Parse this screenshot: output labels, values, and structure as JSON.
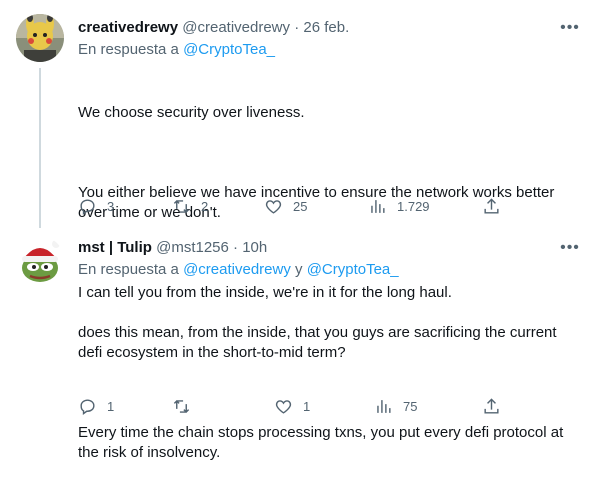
{
  "tweets": [
    {
      "name": "creativedrewy",
      "handle": "@creativedrewy",
      "dot": "·",
      "time": "26 feb.",
      "reply_prefix": "En respuesta a ",
      "reply_mention1": "@CryptoTea_",
      "reply_and": "",
      "reply_mention2": "",
      "paragraphs": [
        "We choose security over liveness.",
        "You either believe we have incentive to ensure the network works better over time or we don't.",
        "I can tell you from the inside, we're in it for the long haul."
      ],
      "replies": "3",
      "retweets": "2",
      "likes": "25",
      "views": "1.729",
      "more_icon": "ellipsis-icon"
    },
    {
      "name": "mst | Tulip",
      "handle": "@mst1256",
      "dot": "·",
      "time": "10h",
      "reply_prefix": "En respuesta a ",
      "reply_mention1": "@creativedrewy",
      "reply_and": " y ",
      "reply_mention2": "@CryptoTea_",
      "paragraphs": [
        "does this mean, from the inside, that you guys are sacrificing the current defi ecosystem in the short-to-mid term?",
        "Every time the chain stops processing txns, you put every defi protocol at the risk of insolvency."
      ],
      "replies": "1",
      "retweets": "",
      "likes": "1",
      "views": "75",
      "more_icon": "ellipsis-icon"
    }
  ],
  "colors": {
    "link": "#1d9bf0",
    "secondary_text": "#536471",
    "primary_text": "#0f1419",
    "thread_line": "#cfd9de"
  }
}
